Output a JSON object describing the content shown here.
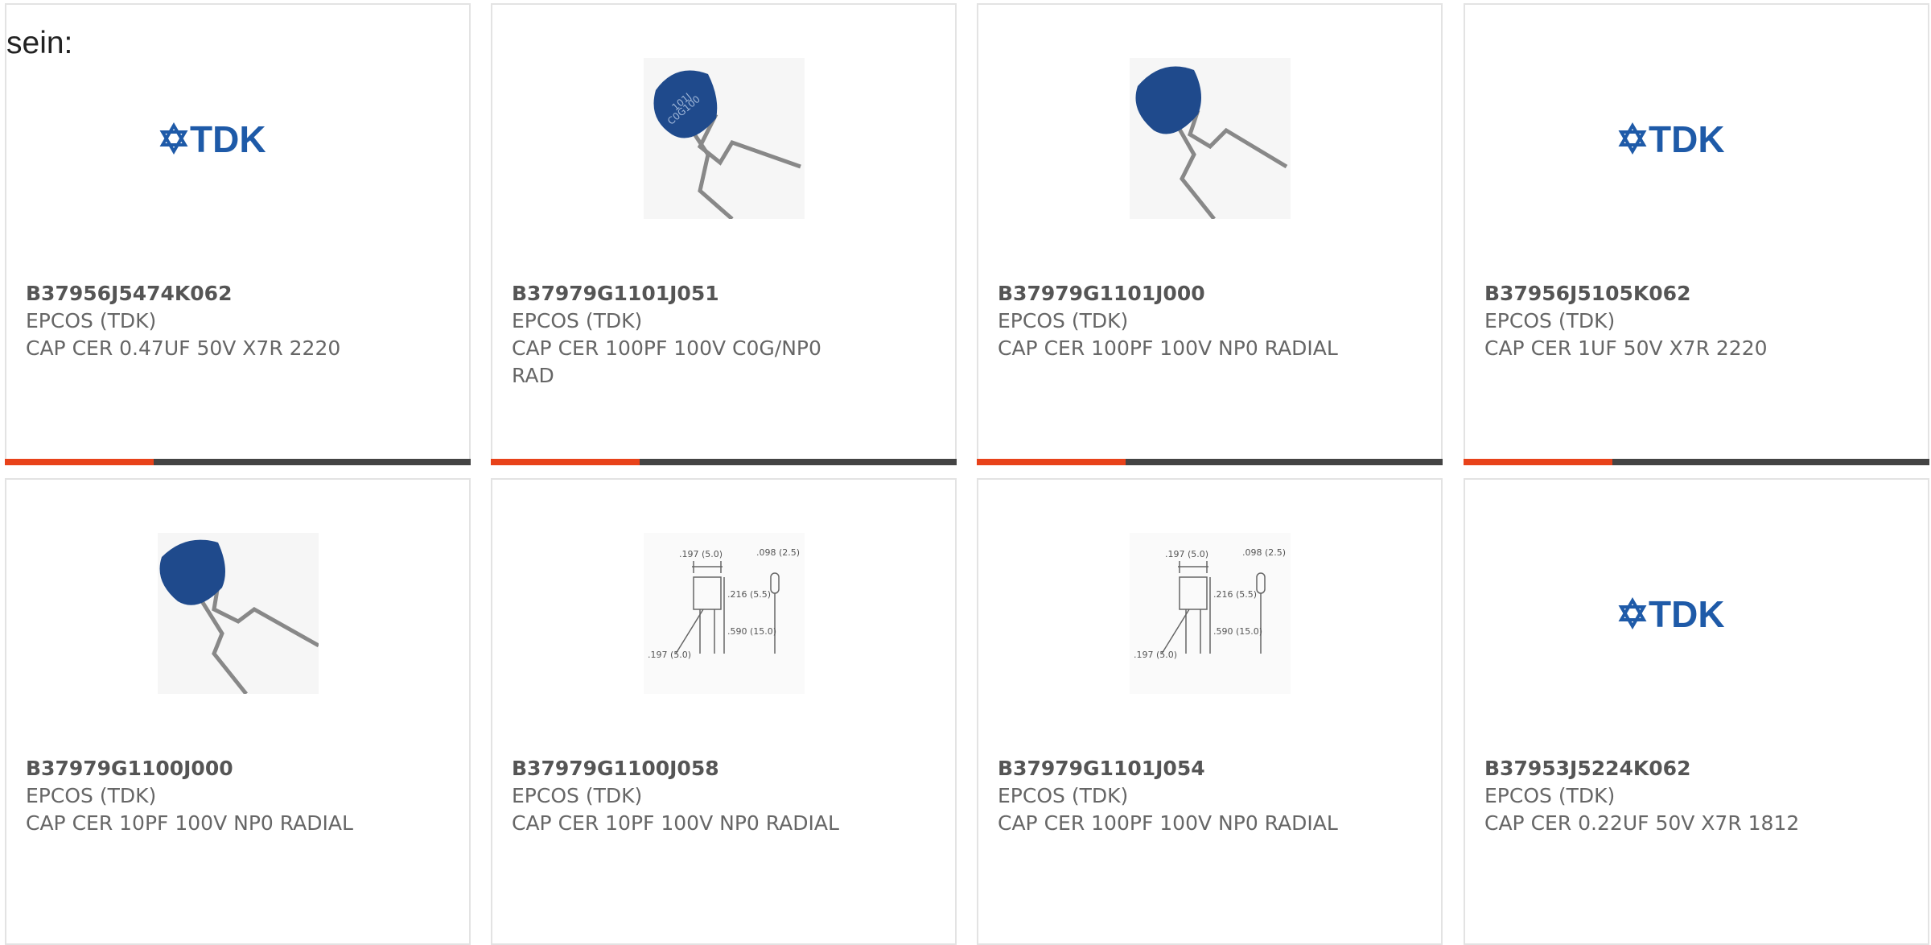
{
  "intro_text": "sein:",
  "colors": {
    "accent": "#e8421a",
    "bar": "#444444",
    "brand_tdk": "#1e5aa8",
    "capacitor_blue": "#1f4a8c"
  },
  "products": [
    {
      "part": "B37956J5474K062",
      "maker": "EPCOS (TDK)",
      "desc": "CAP CER 0.47UF 50V X7R 2220",
      "image": "tdk-logo",
      "progress": 0.32
    },
    {
      "part": "B37979G1101J051",
      "maker": "EPCOS (TDK)",
      "desc": "CAP CER 100PF 100V C0G/NP0 RAD",
      "image": "radial-capacitor-photo",
      "progress": 0.32
    },
    {
      "part": "B37979G1101J000",
      "maker": "EPCOS (TDK)",
      "desc": "CAP CER 100PF 100V NP0 RADIAL",
      "image": "radial-capacitor-photo",
      "progress": 0.32
    },
    {
      "part": "B37956J5105K062",
      "maker": "EPCOS (TDK)",
      "desc": "CAP CER 1UF 50V X7R 2220",
      "image": "tdk-logo",
      "progress": 0.32
    },
    {
      "part": "B37979G1100J000",
      "maker": "EPCOS (TDK)",
      "desc": "CAP CER 10PF 100V NP0 RADIAL",
      "image": "radial-capacitor-photo"
    },
    {
      "part": "B37979G1100J058",
      "maker": "EPCOS (TDK)",
      "desc": "CAP CER 10PF 100V NP0 RADIAL",
      "image": "dimension-drawing"
    },
    {
      "part": "B37979G1101J054",
      "maker": "EPCOS (TDK)",
      "desc": "CAP CER 100PF 100V NP0 RADIAL",
      "image": "dimension-drawing"
    },
    {
      "part": "B37953J5224K062",
      "maker": "EPCOS (TDK)",
      "desc": "CAP CER 0.22UF 50V X7R 1812",
      "image": "tdk-logo"
    }
  ],
  "drawing_labels": {
    "top_width": ".197 (5.0)",
    "lead_dia": ".098 (2.5)",
    "body_height": ".216 (5.5)",
    "lead_length": ".590 (15.0)",
    "bottom_width": ".197 (5.0)"
  },
  "logo_text": "TDK"
}
